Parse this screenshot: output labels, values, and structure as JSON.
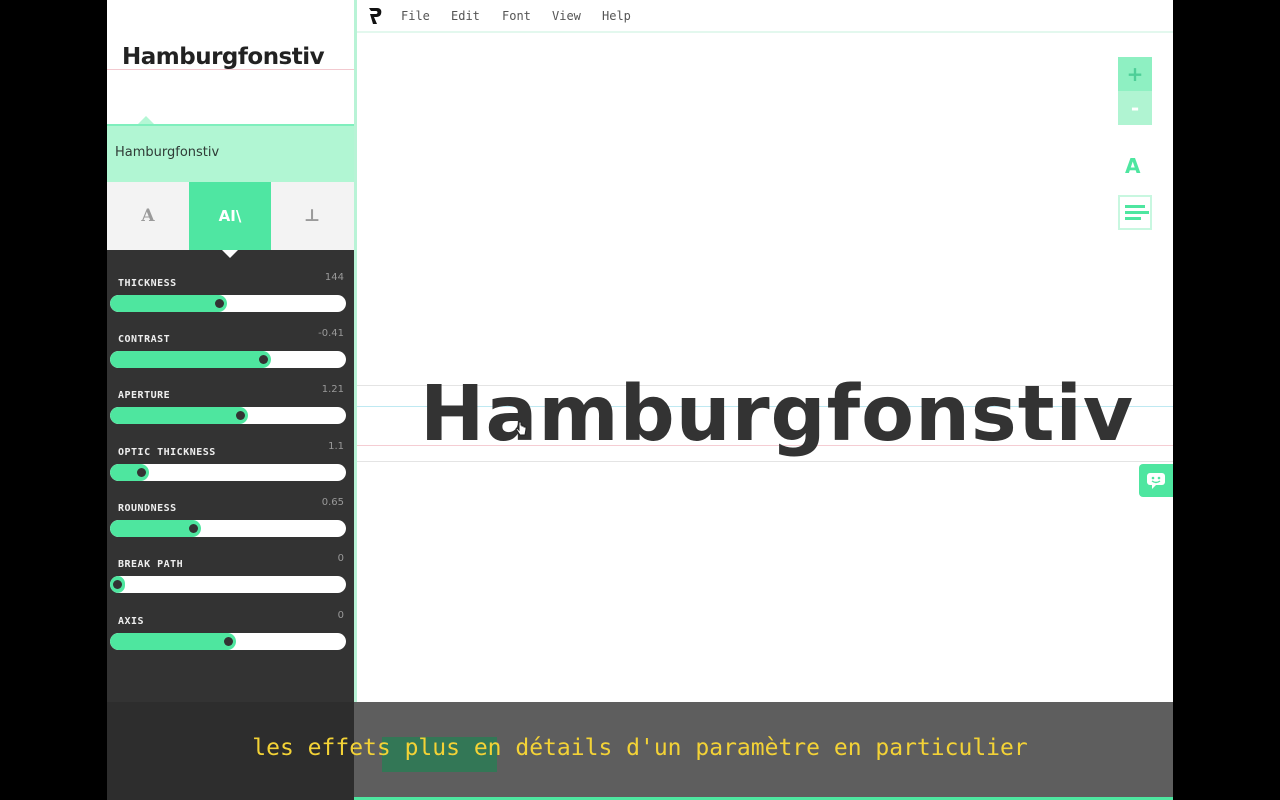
{
  "sidebar": {
    "preview_title": "Hamburgfonstiv",
    "font_name": "Hamburgfonstiv",
    "mode_tabs": [
      {
        "name": "font-settings-tab",
        "glyph": "A",
        "active": false
      },
      {
        "name": "glyph-settings-tab",
        "glyph": "AI\\",
        "active": true
      },
      {
        "name": "serif-settings-tab",
        "glyph": "⊥",
        "active": false
      }
    ],
    "sliders": [
      {
        "label": "THICKNESS",
        "value": "144",
        "fraction": 0.46
      },
      {
        "label": "CONTRAST",
        "value": "-0.41",
        "fraction": 0.65
      },
      {
        "label": "APERTURE",
        "value": "1.21",
        "fraction": 0.55
      },
      {
        "label": "OPTIC THICKNESS",
        "value": "1.1",
        "fraction": 0.13
      },
      {
        "label": "ROUNDNESS",
        "value": "0.65",
        "fraction": 0.35
      },
      {
        "label": "BREAK PATH",
        "value": "0",
        "fraction": 0.03
      },
      {
        "label": "AXIS",
        "value": "0",
        "fraction": 0.5
      }
    ]
  },
  "menu": {
    "items": [
      "File",
      "Edit",
      "Font",
      "View",
      "Help"
    ]
  },
  "toolbar": {
    "zoom_in_label": "+",
    "zoom_out_label": "-",
    "text_tool_label": "A"
  },
  "canvas": {
    "main_text": "Hamburgfonstiv"
  },
  "subtitle": "les effets plus en détails d'un paramètre en particulier",
  "colors": {
    "accent": "#4ee6a0",
    "accent_light": "#b1f6d3",
    "sidebar_bg": "#333333",
    "subtitle": "#f3d236"
  }
}
